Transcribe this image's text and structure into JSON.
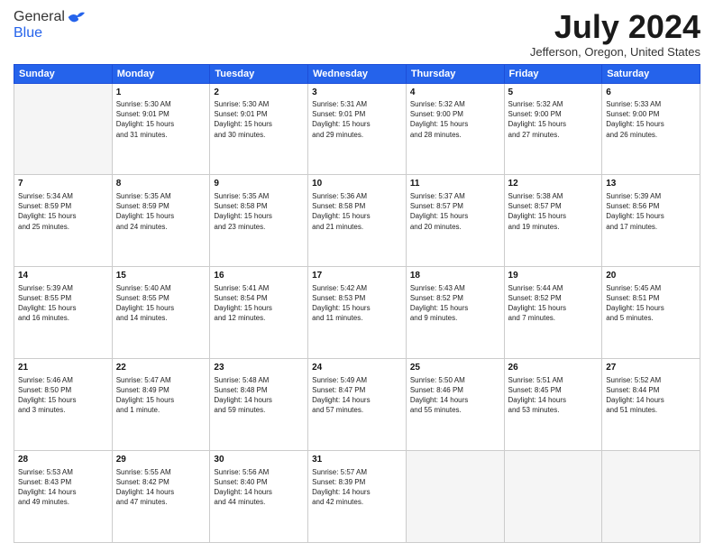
{
  "logo": {
    "general": "General",
    "blue": "Blue"
  },
  "title": "July 2024",
  "location": "Jefferson, Oregon, United States",
  "days_header": [
    "Sunday",
    "Monday",
    "Tuesday",
    "Wednesday",
    "Thursday",
    "Friday",
    "Saturday"
  ],
  "weeks": [
    [
      {
        "day": "",
        "info": ""
      },
      {
        "day": "1",
        "info": "Sunrise: 5:30 AM\nSunset: 9:01 PM\nDaylight: 15 hours\nand 31 minutes."
      },
      {
        "day": "2",
        "info": "Sunrise: 5:30 AM\nSunset: 9:01 PM\nDaylight: 15 hours\nand 30 minutes."
      },
      {
        "day": "3",
        "info": "Sunrise: 5:31 AM\nSunset: 9:01 PM\nDaylight: 15 hours\nand 29 minutes."
      },
      {
        "day": "4",
        "info": "Sunrise: 5:32 AM\nSunset: 9:00 PM\nDaylight: 15 hours\nand 28 minutes."
      },
      {
        "day": "5",
        "info": "Sunrise: 5:32 AM\nSunset: 9:00 PM\nDaylight: 15 hours\nand 27 minutes."
      },
      {
        "day": "6",
        "info": "Sunrise: 5:33 AM\nSunset: 9:00 PM\nDaylight: 15 hours\nand 26 minutes."
      }
    ],
    [
      {
        "day": "7",
        "info": "Sunrise: 5:34 AM\nSunset: 8:59 PM\nDaylight: 15 hours\nand 25 minutes."
      },
      {
        "day": "8",
        "info": "Sunrise: 5:35 AM\nSunset: 8:59 PM\nDaylight: 15 hours\nand 24 minutes."
      },
      {
        "day": "9",
        "info": "Sunrise: 5:35 AM\nSunset: 8:58 PM\nDaylight: 15 hours\nand 23 minutes."
      },
      {
        "day": "10",
        "info": "Sunrise: 5:36 AM\nSunset: 8:58 PM\nDaylight: 15 hours\nand 21 minutes."
      },
      {
        "day": "11",
        "info": "Sunrise: 5:37 AM\nSunset: 8:57 PM\nDaylight: 15 hours\nand 20 minutes."
      },
      {
        "day": "12",
        "info": "Sunrise: 5:38 AM\nSunset: 8:57 PM\nDaylight: 15 hours\nand 19 minutes."
      },
      {
        "day": "13",
        "info": "Sunrise: 5:39 AM\nSunset: 8:56 PM\nDaylight: 15 hours\nand 17 minutes."
      }
    ],
    [
      {
        "day": "14",
        "info": "Sunrise: 5:39 AM\nSunset: 8:55 PM\nDaylight: 15 hours\nand 16 minutes."
      },
      {
        "day": "15",
        "info": "Sunrise: 5:40 AM\nSunset: 8:55 PM\nDaylight: 15 hours\nand 14 minutes."
      },
      {
        "day": "16",
        "info": "Sunrise: 5:41 AM\nSunset: 8:54 PM\nDaylight: 15 hours\nand 12 minutes."
      },
      {
        "day": "17",
        "info": "Sunrise: 5:42 AM\nSunset: 8:53 PM\nDaylight: 15 hours\nand 11 minutes."
      },
      {
        "day": "18",
        "info": "Sunrise: 5:43 AM\nSunset: 8:52 PM\nDaylight: 15 hours\nand 9 minutes."
      },
      {
        "day": "19",
        "info": "Sunrise: 5:44 AM\nSunset: 8:52 PM\nDaylight: 15 hours\nand 7 minutes."
      },
      {
        "day": "20",
        "info": "Sunrise: 5:45 AM\nSunset: 8:51 PM\nDaylight: 15 hours\nand 5 minutes."
      }
    ],
    [
      {
        "day": "21",
        "info": "Sunrise: 5:46 AM\nSunset: 8:50 PM\nDaylight: 15 hours\nand 3 minutes."
      },
      {
        "day": "22",
        "info": "Sunrise: 5:47 AM\nSunset: 8:49 PM\nDaylight: 15 hours\nand 1 minute."
      },
      {
        "day": "23",
        "info": "Sunrise: 5:48 AM\nSunset: 8:48 PM\nDaylight: 14 hours\nand 59 minutes."
      },
      {
        "day": "24",
        "info": "Sunrise: 5:49 AM\nSunset: 8:47 PM\nDaylight: 14 hours\nand 57 minutes."
      },
      {
        "day": "25",
        "info": "Sunrise: 5:50 AM\nSunset: 8:46 PM\nDaylight: 14 hours\nand 55 minutes."
      },
      {
        "day": "26",
        "info": "Sunrise: 5:51 AM\nSunset: 8:45 PM\nDaylight: 14 hours\nand 53 minutes."
      },
      {
        "day": "27",
        "info": "Sunrise: 5:52 AM\nSunset: 8:44 PM\nDaylight: 14 hours\nand 51 minutes."
      }
    ],
    [
      {
        "day": "28",
        "info": "Sunrise: 5:53 AM\nSunset: 8:43 PM\nDaylight: 14 hours\nand 49 minutes."
      },
      {
        "day": "29",
        "info": "Sunrise: 5:55 AM\nSunset: 8:42 PM\nDaylight: 14 hours\nand 47 minutes."
      },
      {
        "day": "30",
        "info": "Sunrise: 5:56 AM\nSunset: 8:40 PM\nDaylight: 14 hours\nand 44 minutes."
      },
      {
        "day": "31",
        "info": "Sunrise: 5:57 AM\nSunset: 8:39 PM\nDaylight: 14 hours\nand 42 minutes."
      },
      {
        "day": "",
        "info": ""
      },
      {
        "day": "",
        "info": ""
      },
      {
        "day": "",
        "info": ""
      }
    ]
  ]
}
